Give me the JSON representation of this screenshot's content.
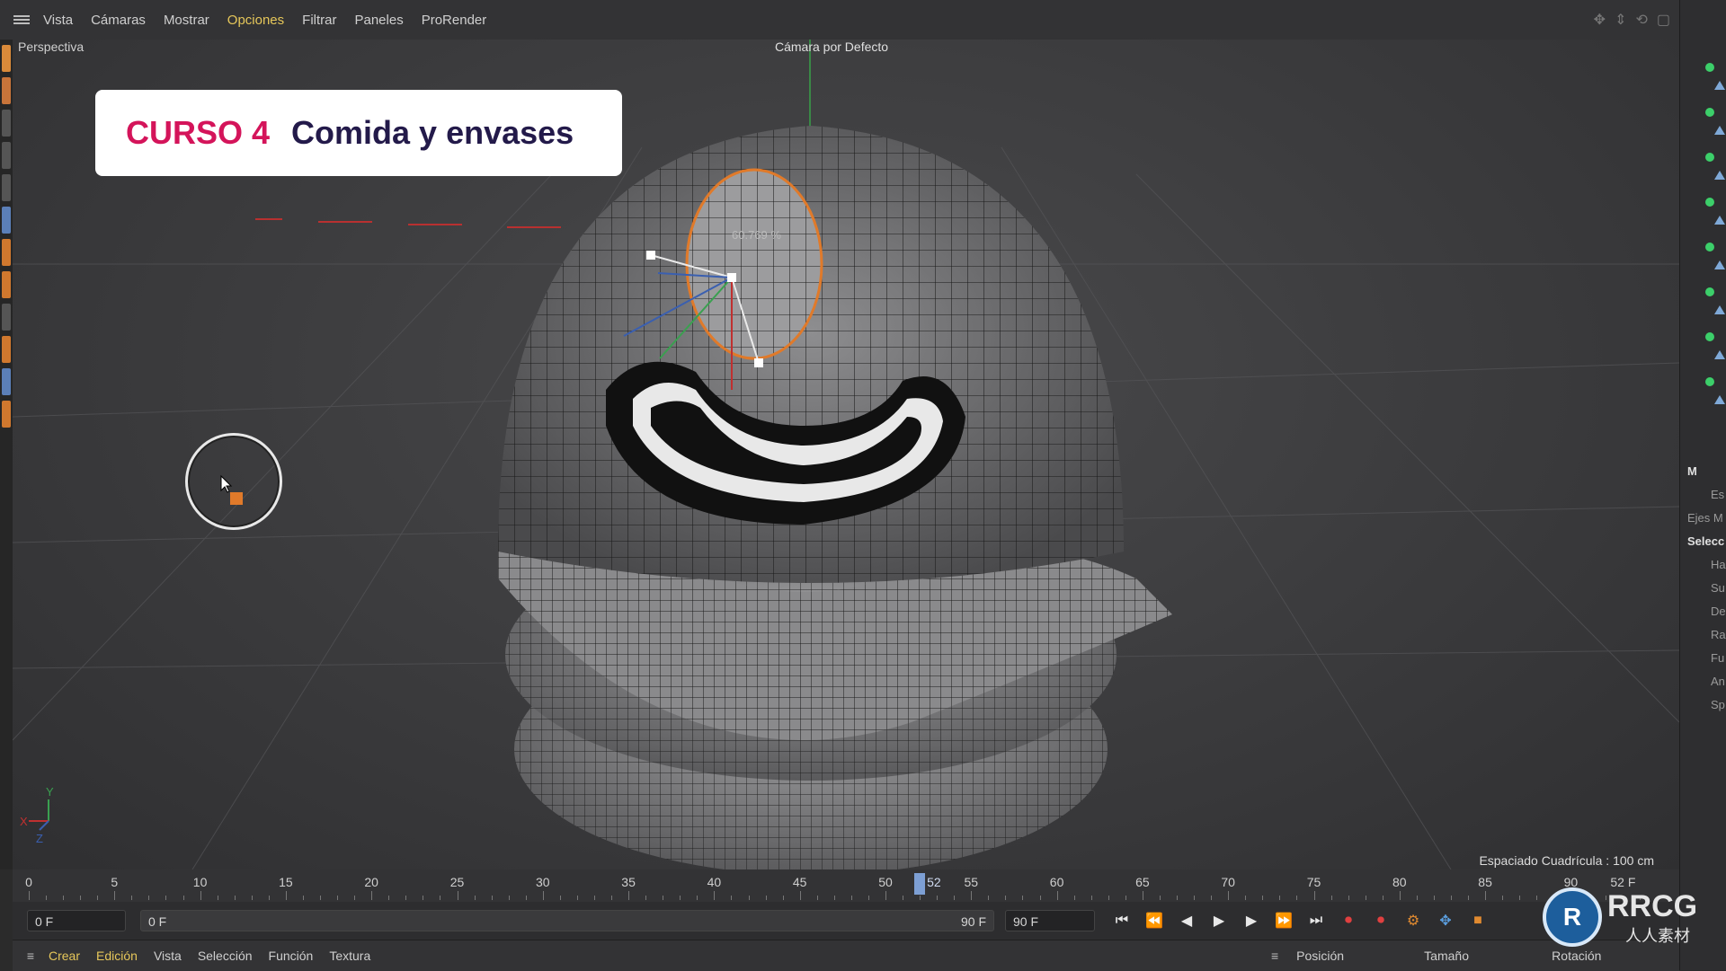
{
  "menubar": {
    "items": [
      {
        "label": "Vista"
      },
      {
        "label": "Cámaras"
      },
      {
        "label": "Mostrar"
      },
      {
        "label": "Opciones",
        "active": true
      },
      {
        "label": "Filtrar"
      },
      {
        "label": "Paneles"
      },
      {
        "label": "ProRender"
      }
    ]
  },
  "viewport": {
    "view_name": "Perspectiva",
    "camera": "Cámara por Defecto",
    "grid_spacing": "Espaciado Cuadrícula : 100 cm",
    "handle_value": "60.769 %",
    "axis_x": "X",
    "axis_y": "Y",
    "axis_z": "Z"
  },
  "title_card": {
    "course": "CURSO 4",
    "subject": "Comida y envases"
  },
  "timeline": {
    "ticks": [
      "0",
      "5",
      "10",
      "15",
      "20",
      "25",
      "30",
      "35",
      "40",
      "45",
      "50",
      "55",
      "60",
      "65",
      "70",
      "75",
      "80",
      "85",
      "90"
    ],
    "current_frame": "52",
    "end_marker": "52 F"
  },
  "transport": {
    "current": "0 F",
    "range_start": "0 F",
    "range_end": "90 F",
    "max": "90 F"
  },
  "bottombar": {
    "items": [
      {
        "label": "Crear",
        "active": true
      },
      {
        "label": "Edición",
        "active": true
      },
      {
        "label": "Vista"
      },
      {
        "label": "Selección"
      },
      {
        "label": "Función"
      },
      {
        "label": "Textura"
      }
    ],
    "coord": {
      "position": "Posición",
      "size": "Tamaño",
      "rotation": "Rotación"
    }
  },
  "rightpanel": {
    "mode_label": "M",
    "obj_label": "Es",
    "tab": "Ejes M",
    "section": "Selecc",
    "attrs": [
      "Ha",
      "Su",
      "De",
      "Ra",
      "Fu",
      "An",
      "Sp"
    ]
  },
  "watermark": {
    "brand": "RRCG",
    "sub": "人人素材"
  },
  "colors": {
    "accent_yellow": "#e6c75a",
    "title_red": "#d4145a",
    "title_navy": "#231a4a",
    "selection_orange": "#e07a2a"
  }
}
